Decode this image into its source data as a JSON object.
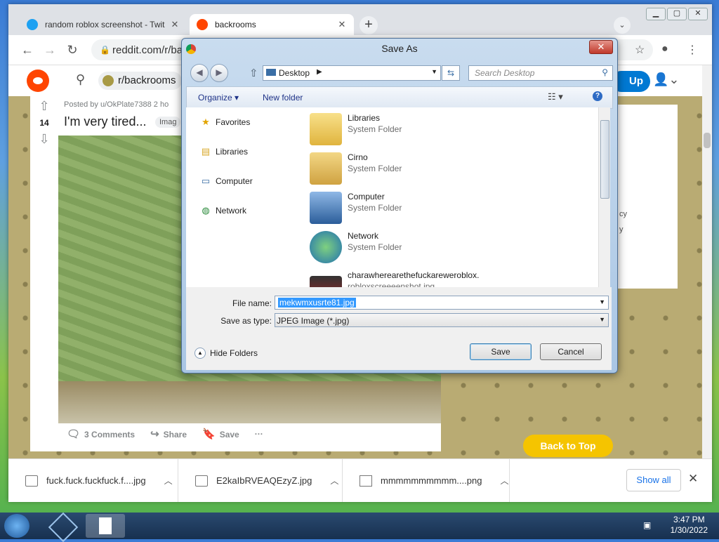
{
  "browser": {
    "tabs": [
      {
        "title": "random roblox screenshot - Twit",
        "icon": "twitter-icon"
      },
      {
        "title": "backrooms",
        "icon": "reddit-icon"
      }
    ],
    "url": "reddit.com/r/ba",
    "window_controls": [
      "minimize",
      "maximize",
      "close"
    ]
  },
  "reddit": {
    "subreddit": "r/backrooms",
    "signup_label": "Up",
    "post": {
      "meta": "Posted by u/OkPlate7388 2 ho",
      "title": "I'm very tired...",
      "flair": "Imag",
      "votes": "14",
      "comments": "3 Comments",
      "share": "Share",
      "save": "Save",
      "more": "···"
    },
    "sidebar_fragments": [
      "cy",
      "y"
    ],
    "back_to_top": "Back to Top"
  },
  "dialog": {
    "title": "Save As",
    "address": "Desktop",
    "search_placeholder": "Search Desktop",
    "organize": "Organize",
    "new_folder": "New folder",
    "nav": [
      {
        "label": "Favorites",
        "icon": "star-icon"
      },
      {
        "label": "Libraries",
        "icon": "library-icon"
      },
      {
        "label": "Computer",
        "icon": "computer-icon"
      },
      {
        "label": "Network",
        "icon": "network-icon"
      }
    ],
    "files": [
      {
        "name": "Libraries",
        "kind": "System Folder"
      },
      {
        "name": "Cirno",
        "kind": "System Folder"
      },
      {
        "name": "Computer",
        "kind": "System Folder"
      },
      {
        "name": "Network",
        "kind": "System Folder"
      },
      {
        "name": "charawherearethefuckareweroblox.",
        "kind": "robloxscreeeenshot.jpg"
      }
    ],
    "file_name_label": "File name:",
    "file_name_value": "mekwmxusrte81.jpg",
    "save_type_label": "Save as type:",
    "save_type_value": "JPEG Image (*.jpg)",
    "hide_folders": "Hide Folders",
    "save_button": "Save",
    "cancel_button": "Cancel"
  },
  "downloads": {
    "items": [
      {
        "name": "fuck.fuck.fuckfuck.f....jpg"
      },
      {
        "name": "E2kaIbRVEAQEzyZ.jpg"
      },
      {
        "name": "mmmmmmmmmm....png"
      }
    ],
    "show_all": "Show all"
  },
  "taskbar": {
    "time": "3:47 PM",
    "date": "1/30/2022"
  },
  "colors": {
    "reddit_orange": "#ff4500",
    "reddit_blue": "#0079d3",
    "back_to_top": "#f5c400",
    "selection": "#3399ff"
  }
}
